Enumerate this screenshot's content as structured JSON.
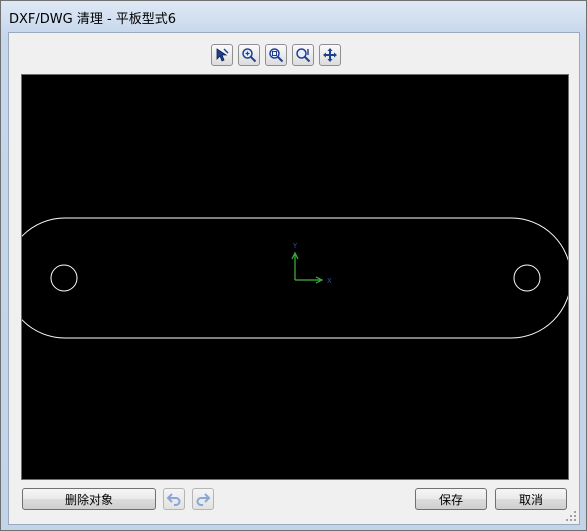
{
  "window": {
    "title": "DXF/DWG 清理 - 平板型式6"
  },
  "toolbar": {
    "tools": [
      {
        "name": "select-tool-icon"
      },
      {
        "name": "zoom-in-icon"
      },
      {
        "name": "zoom-window-icon"
      },
      {
        "name": "zoom-fit-icon"
      },
      {
        "name": "pan-icon"
      }
    ]
  },
  "canvas": {
    "background": "#000000",
    "line_color": "#ffffff",
    "axis_x_label": "X",
    "axis_y_label": "Y",
    "axis_x_color": "#3fb63f",
    "axis_y_color": "#3fb63f"
  },
  "buttons": {
    "delete_object": "删除对象",
    "undo": "undo-icon",
    "redo": "redo-icon",
    "save": "保存",
    "cancel": "取消"
  }
}
